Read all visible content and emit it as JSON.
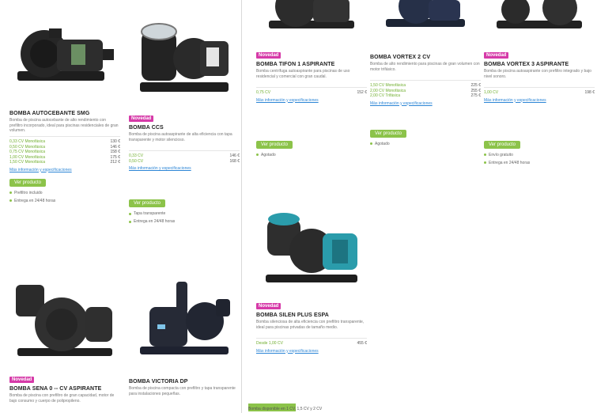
{
  "colors": {
    "badge": "#d63aa8",
    "cta": "#8cc34a",
    "link": "#2d86d6",
    "price_label": "#6fae2d"
  },
  "left": {
    "products": [
      {
        "badge": "",
        "title": "BOMBA AUTOCEBANTE SMG",
        "desc": "Bomba de piscina autocebante de alto rendimiento con prefiltro incorporado, ideal para piscinas residenciales de gran volumen.",
        "prices": [
          [
            "0,33 CV Monofásica",
            "130 €"
          ],
          [
            "0,50 CV Monofásica",
            "146 €"
          ],
          [
            "0,75 CV Monofásica",
            "158 €"
          ],
          [
            "1,00 CV Monofásica",
            "175 €"
          ],
          [
            "1,50 CV Monofásica",
            "212 €"
          ]
        ],
        "link": "Más información y especificaciones",
        "cta": "Ver producto",
        "bullets": [
          "Prefiltro incluido",
          "Entrega en 24/48 horas"
        ]
      },
      {
        "badge": "Novedad",
        "title": "BOMBA CCS",
        "desc": "Bomba de piscina autoaspirante de alta eficiencia con tapa transparente y motor silencioso.",
        "prices": [
          [
            "0,33 CV",
            "146 €"
          ],
          [
            "0,50 CV",
            "168 €"
          ]
        ],
        "link": "Más información y especificaciones",
        "cta": "Ver producto",
        "bullets": [
          "Tapa transparente",
          "Entrega en 24/48 horas"
        ]
      },
      {
        "badge": "Novedad",
        "title": "BOMBA SENA 0 -- CV ASPIRANTE",
        "desc": "Bomba de piscina con prefiltro de gran capacidad, motor de bajo consumo y cuerpo de polipropileno.",
        "prices": [],
        "link": "",
        "cta": "",
        "bullets": []
      },
      {
        "badge": "",
        "title": "BOMBA VICTORIA DP",
        "desc": "Bomba de piscina compacta con prefiltro y tapa transparente para instalaciones pequeñas.",
        "prices": [],
        "link": "",
        "cta": "",
        "bullets": []
      }
    ]
  },
  "right": {
    "products": [
      {
        "badge": "Novedad",
        "title": "BOMBA TIFON 1 ASPIRANTE",
        "desc": "Bomba centrífuga autoaspirante para piscinas de uso residencial y comercial con gran caudal.",
        "prices": [
          [
            "0,75 CV",
            "152 €"
          ]
        ],
        "link": "Más información y especificaciones",
        "cta": "Ver producto",
        "bullets": [
          "Agotado"
        ]
      },
      {
        "badge": "",
        "title": "BOMBA VORTEX 2 CV",
        "desc": "Bomba de alto rendimiento para piscinas de gran volumen con motor trifásico.",
        "prices": [
          [
            "1,50 CV Monofásica",
            "225 €"
          ],
          [
            "2,00 CV Monofásica",
            "255 €"
          ],
          [
            "2,00 CV Trifásica",
            "275 €"
          ]
        ],
        "link": "Más información y especificaciones",
        "cta": "Ver producto",
        "bullets": [
          "Agotado"
        ]
      },
      {
        "badge": "Novedad",
        "title": "BOMBA VORTEX 3 ASPIRANTE",
        "desc": "Bomba de piscina autoaspirante con prefiltro integrado y bajo nivel sonoro.",
        "prices": [
          [
            "1,00 CV",
            "198 €"
          ]
        ],
        "link": "Más información y especificaciones",
        "cta": "Ver producto",
        "bullets": [
          "Envío gratuito",
          "Entrega en 24/48 horas"
        ]
      },
      {
        "badge": "Novedad",
        "title": "BOMBA SILEN PLUS ESPA",
        "desc": "Bomba silenciosa de alta eficiencia con prefiltro transparente, ideal para piscinas privadas de tamaño medio.",
        "prices": [
          [
            "Desde 1,00 CV",
            "455 €"
          ]
        ],
        "link": "Más información y especificaciones",
        "cta": "",
        "bullets": []
      }
    ],
    "bottom_note": "Bomba disponible en 1 CV, 1,5 CV y 2 CV"
  }
}
